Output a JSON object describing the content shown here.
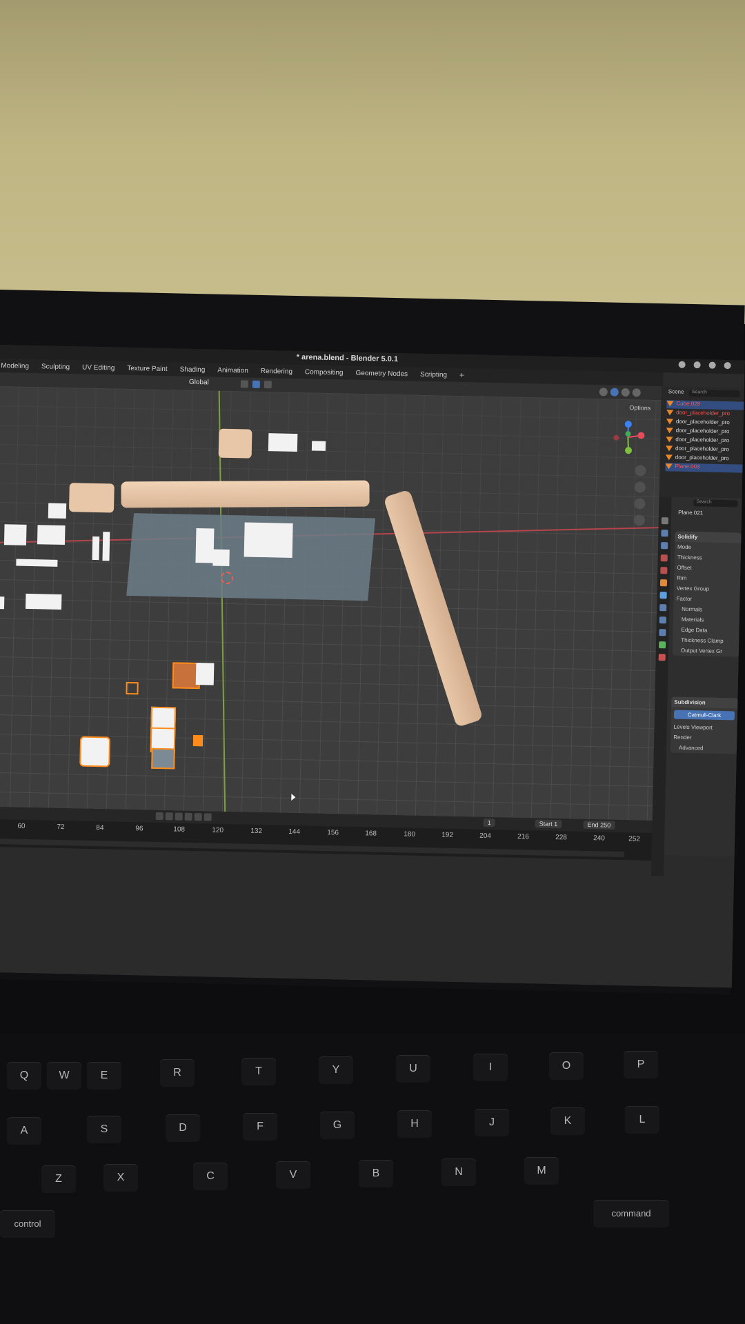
{
  "window": {
    "title": "* arena.blend - Blender 5.0.1"
  },
  "workspace_tabs": [
    "Modeling",
    "Sculpting",
    "UV Editing",
    "Texture Paint",
    "Shading",
    "Animation",
    "Rendering",
    "Compositing",
    "Geometry Nodes",
    "Scripting"
  ],
  "viewport_header": {
    "orientation": "Global",
    "options_label": "Options"
  },
  "outliner": {
    "scene_label": "Scene",
    "search_placeholder": "Search",
    "items": [
      {
        "label": "Cube.028",
        "state": "selected-red"
      },
      {
        "label": "door_placeholder_pro",
        "state": "red"
      },
      {
        "label": "door_placeholder_pro",
        "state": "normal"
      },
      {
        "label": "door_placeholder_pro",
        "state": "normal"
      },
      {
        "label": "door_placeholder_pro",
        "state": "normal"
      },
      {
        "label": "door_placeholder_pro",
        "state": "normal"
      },
      {
        "label": "door_placeholder_pro",
        "state": "normal"
      },
      {
        "label": "Plane.003",
        "state": "selected-red"
      }
    ]
  },
  "properties": {
    "search_placeholder": "Search",
    "object_name": "Plane.021",
    "solidify": {
      "header": "Solidify",
      "rows": [
        "Mode",
        "Thickness",
        "Offset",
        "Rim",
        "Vertex Group",
        "Factor"
      ],
      "subpanels": [
        "Normals",
        "Materials",
        "Edge Data",
        "Thickness Clamp",
        "Output Vertex Gr"
      ]
    },
    "subdivision": {
      "header": "Subdivision",
      "mode_button": "Catmull-Clark",
      "rows": [
        "Levels Viewport",
        "Render"
      ],
      "subpanels": [
        "Advanced"
      ]
    }
  },
  "timeline": {
    "current_frame": "1",
    "start_label": "Start",
    "start_value": "1",
    "end_label": "End",
    "end_value": "250",
    "ruler_ticks": [
      "60",
      "72",
      "84",
      "96",
      "108",
      "120",
      "132",
      "144",
      "156",
      "168",
      "180",
      "192",
      "204",
      "216",
      "228",
      "240",
      "252"
    ]
  },
  "keyboard": {
    "row_qwerty": [
      "Q",
      "W",
      "E",
      "R",
      "T",
      "Y",
      "U",
      "I",
      "O",
      "P"
    ],
    "row_asdf": [
      "A",
      "S",
      "D",
      "F",
      "G",
      "H",
      "J",
      "K",
      "L"
    ],
    "row_zxcv": [
      "Z",
      "X",
      "C",
      "V",
      "B",
      "N",
      "M"
    ],
    "modifier_left": "control",
    "modifier_right": "command"
  },
  "colors": {
    "selection_blue": "#4772b3",
    "x_axis": "#b5454b",
    "y_axis": "#7fa13d",
    "object_orange": "#ff8c1a",
    "wall_tan": "#e8c7a8"
  }
}
